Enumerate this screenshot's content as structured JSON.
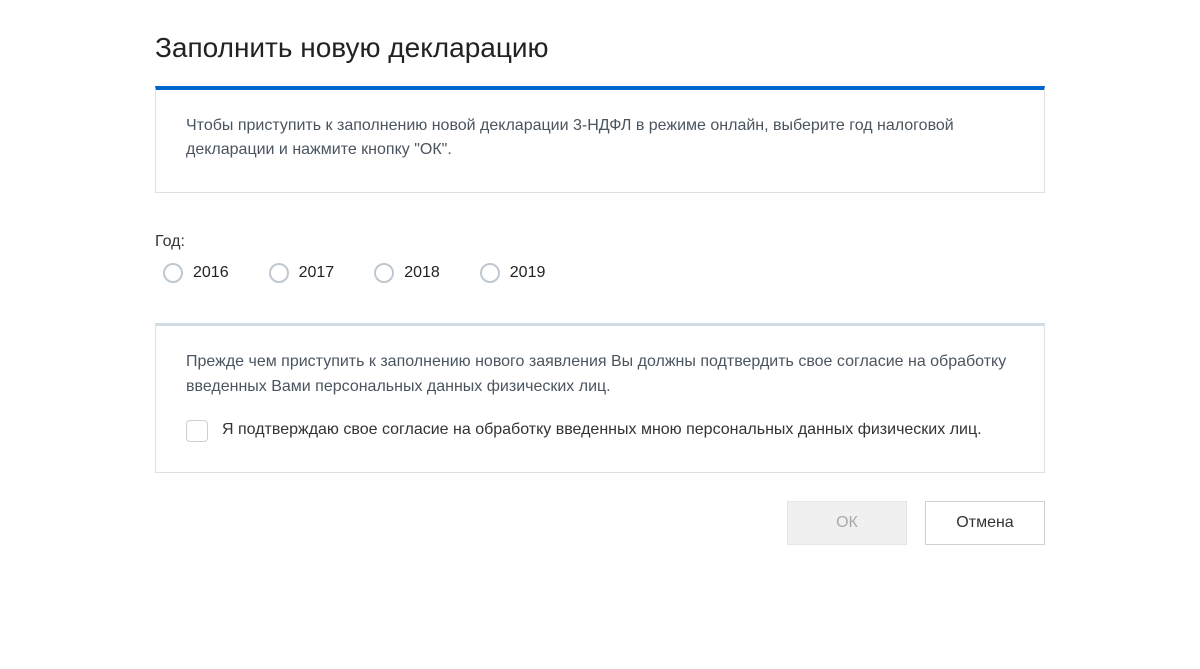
{
  "title": "Заполнить новую декларацию",
  "info": "Чтобы приступить к заполнению новой декларации 3-НДФЛ в режиме онлайн, выберите год налоговой декларации и нажмите кнопку \"ОК\".",
  "year": {
    "label": "Год:",
    "options": [
      "2016",
      "2017",
      "2018",
      "2019"
    ]
  },
  "consent": {
    "intro": "Прежде чем приступить к заполнению нового заявления Вы должны подтвердить свое согласие на обработку введенных Вами персональных данных физических лиц.",
    "checkbox_label": "Я подтверждаю свое согласие на обработку введенных мною персональных данных физических лиц."
  },
  "buttons": {
    "ok": "ОК",
    "cancel": "Отмена"
  }
}
